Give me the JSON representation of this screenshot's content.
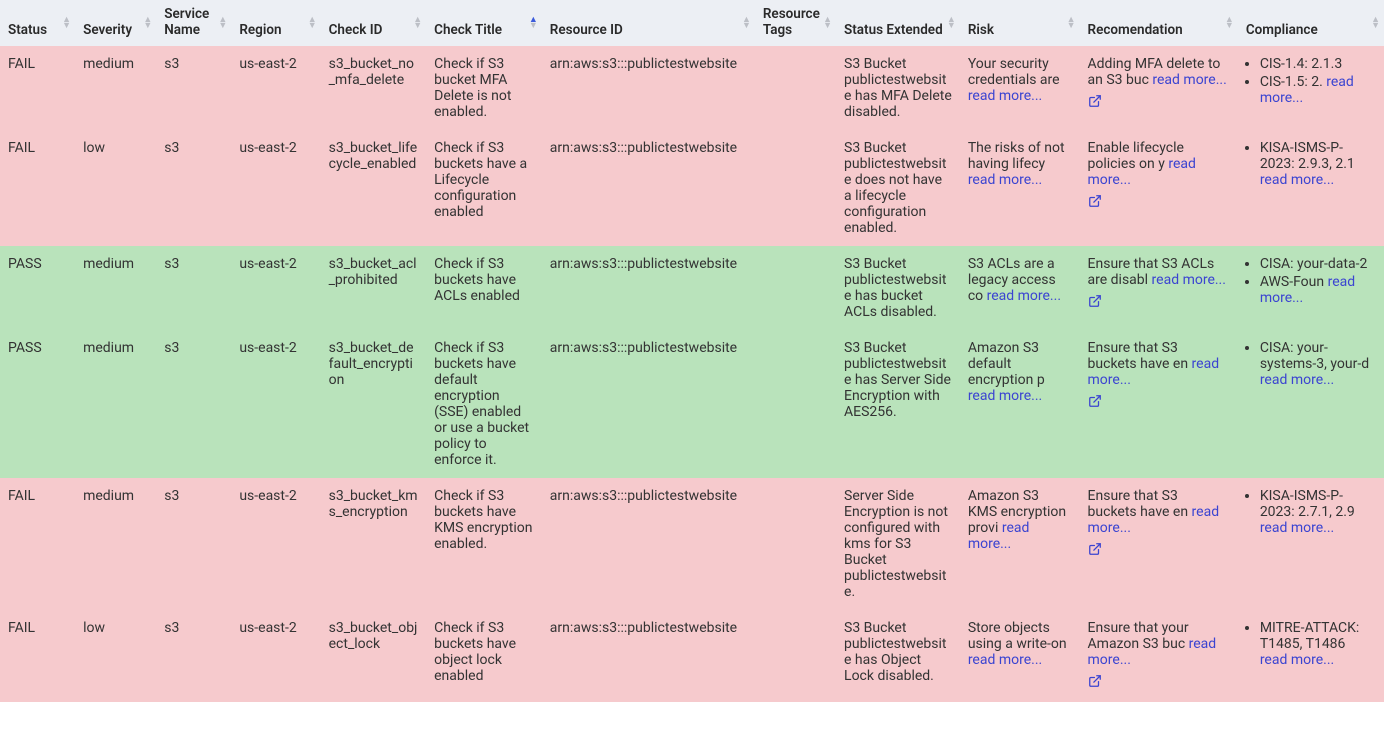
{
  "columns": [
    {
      "key": "status",
      "label": "Status",
      "sortable": true,
      "sorted": null
    },
    {
      "key": "severity",
      "label": "Severity",
      "sortable": true,
      "sorted": null
    },
    {
      "key": "service",
      "label": "Service Name",
      "sortable": true,
      "sorted": null
    },
    {
      "key": "region",
      "label": "Region",
      "sortable": true,
      "sorted": null
    },
    {
      "key": "check_id",
      "label": "Check ID",
      "sortable": true,
      "sorted": null
    },
    {
      "key": "check_title",
      "label": "Check Title",
      "sortable": true,
      "sorted": "asc"
    },
    {
      "key": "resource_id",
      "label": "Resource ID",
      "sortable": true,
      "sorted": null
    },
    {
      "key": "tags",
      "label": "Resource Tags",
      "sortable": true,
      "sorted": null
    },
    {
      "key": "status_ext",
      "label": "Status Extended",
      "sortable": true,
      "sorted": null
    },
    {
      "key": "risk",
      "label": "Risk",
      "sortable": true,
      "sorted": null
    },
    {
      "key": "recommendation",
      "label": "Recomendation",
      "sortable": true,
      "sorted": null
    },
    {
      "key": "compliance",
      "label": "Compliance",
      "sortable": true,
      "sorted": null
    }
  ],
  "read_more_label": "read more...",
  "rows": [
    {
      "status": "FAIL",
      "severity": "medium",
      "service": "s3",
      "region": "us-east-2",
      "check_id": "s3_bucket_no_mfa_delete",
      "check_title": "Check if S3 bucket MFA Delete is not enabled.",
      "resource_id": "arn:aws:s3:::publictestwebsite",
      "tags": "",
      "status_ext": "S3 Bucket publictestwebsite has MFA Delete disabled.",
      "risk_text": "Your security credentials are ",
      "rec_text": "Adding MFA delete to an S3 buc ",
      "rec_has_link": true,
      "compliance": [
        {
          "text": "CIS-1.4: 2.1.3",
          "more": false
        },
        {
          "text": "CIS-1.5: 2. ",
          "more": true
        }
      ]
    },
    {
      "status": "FAIL",
      "severity": "low",
      "service": "s3",
      "region": "us-east-2",
      "check_id": "s3_bucket_lifecycle_enabled",
      "check_title": "Check if S3 buckets have a Lifecycle configuration enabled",
      "resource_id": "arn:aws:s3:::publictestwebsite",
      "tags": "",
      "status_ext": "S3 Bucket publictestwebsite does not have a lifecycle configuration enabled.",
      "risk_text": "The risks of not having lifecy ",
      "rec_text": "Enable lifecycle policies on y ",
      "rec_has_link": true,
      "compliance": [
        {
          "text": "KISA-ISMS-P-2023: 2.9.3, 2.1 ",
          "more": true
        }
      ]
    },
    {
      "status": "PASS",
      "severity": "medium",
      "service": "s3",
      "region": "us-east-2",
      "check_id": "s3_bucket_acl_prohibited",
      "check_title": "Check if S3 buckets have ACLs enabled",
      "resource_id": "arn:aws:s3:::publictestwebsite",
      "tags": "",
      "status_ext": "S3 Bucket publictestwebsite has bucket ACLs disabled.",
      "risk_text": "S3 ACLs are a legacy access co ",
      "rec_text": "Ensure that S3 ACLs are disabl ",
      "rec_has_link": true,
      "compliance": [
        {
          "text": "CISA: your-data-2",
          "more": false
        },
        {
          "text": "AWS-Foun ",
          "more": true
        }
      ]
    },
    {
      "status": "PASS",
      "severity": "medium",
      "service": "s3",
      "region": "us-east-2",
      "check_id": "s3_bucket_default_encryption",
      "check_title": "Check if S3 buckets have default encryption (SSE) enabled or use a bucket policy to enforce it.",
      "resource_id": "arn:aws:s3:::publictestwebsite",
      "tags": "",
      "status_ext": "S3 Bucket publictestwebsite has Server Side Encryption with AES256.",
      "risk_text": "Amazon S3 default encryption p ",
      "rec_text": "Ensure that S3 buckets have en ",
      "rec_has_link": true,
      "compliance": [
        {
          "text": "CISA: your-systems-3, your-d ",
          "more": true
        }
      ]
    },
    {
      "status": "FAIL",
      "severity": "medium",
      "service": "s3",
      "region": "us-east-2",
      "check_id": "s3_bucket_kms_encryption",
      "check_title": "Check if S3 buckets have KMS encryption enabled.",
      "resource_id": "arn:aws:s3:::publictestwebsite",
      "tags": "",
      "status_ext": "Server Side Encryption is not configured with kms for S3 Bucket publictestwebsite.",
      "risk_text": "Amazon S3 KMS encryption provi ",
      "rec_text": "Ensure that S3 buckets have en ",
      "rec_has_link": true,
      "compliance": [
        {
          "text": "KISA-ISMS-P-2023: 2.7.1, 2.9 ",
          "more": true
        }
      ]
    },
    {
      "status": "FAIL",
      "severity": "low",
      "service": "s3",
      "region": "us-east-2",
      "check_id": "s3_bucket_object_lock",
      "check_title": "Check if S3 buckets have object lock enabled",
      "resource_id": "arn:aws:s3:::publictestwebsite",
      "tags": "",
      "status_ext": "S3 Bucket publictestwebsite has Object Lock disabled.",
      "risk_text": "Store objects using a write-on ",
      "rec_text": "Ensure that your Amazon S3 buc ",
      "rec_has_link": true,
      "compliance": [
        {
          "text": "MITRE-ATTACK: T1485, T1486 ",
          "more": true
        }
      ]
    }
  ]
}
